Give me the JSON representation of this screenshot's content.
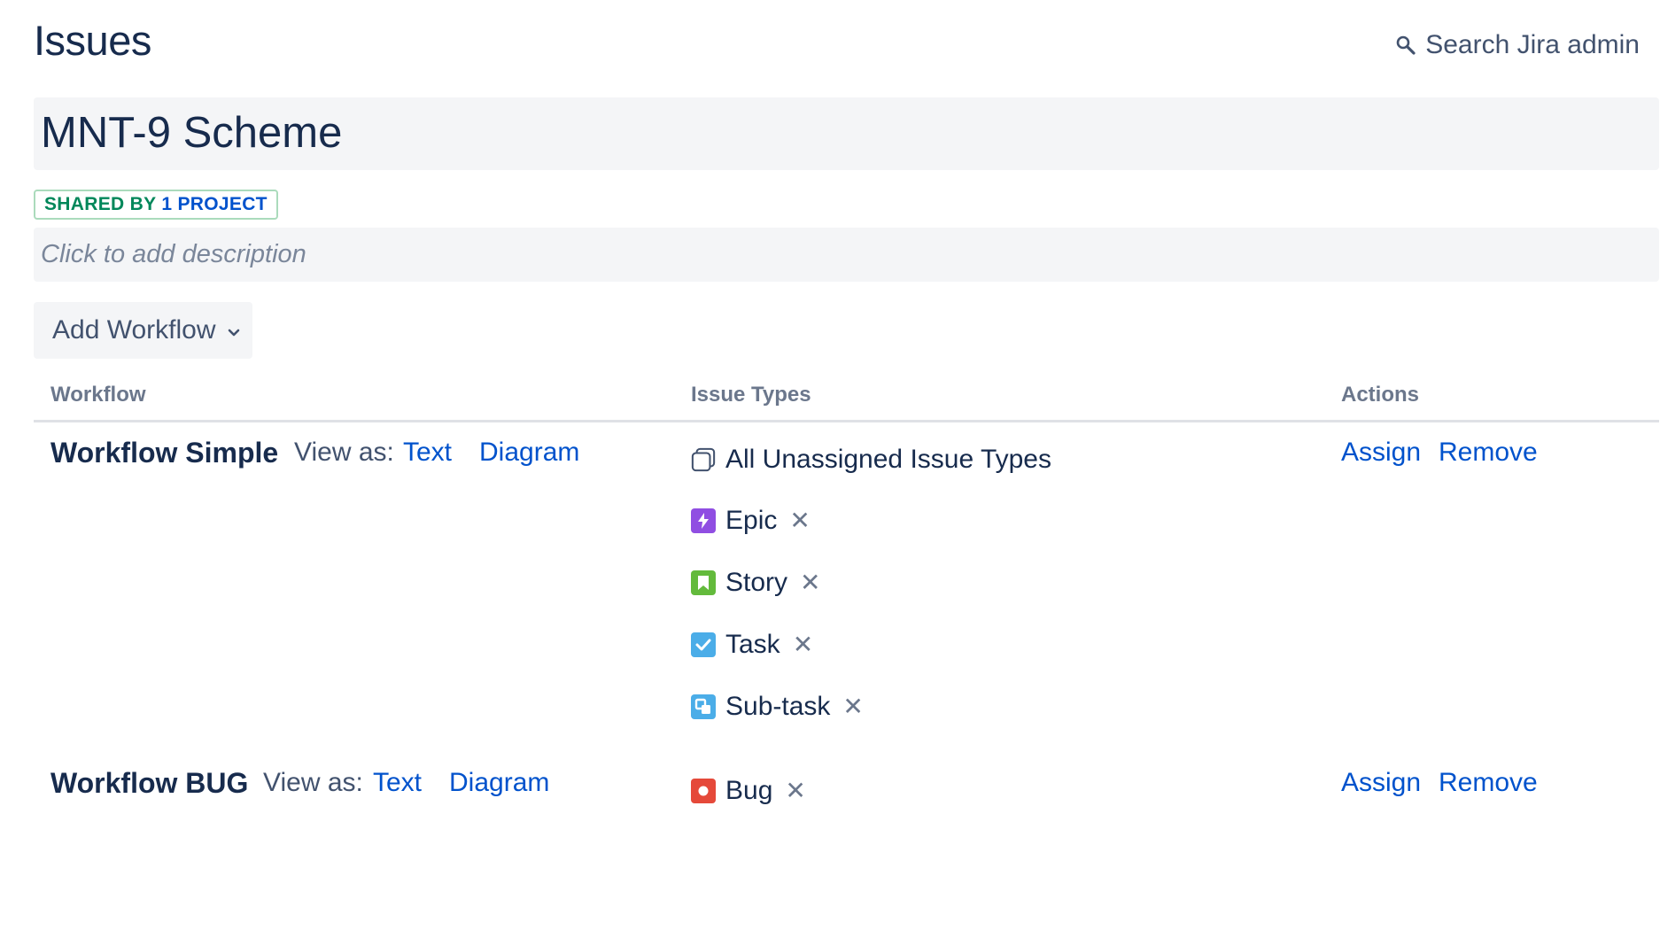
{
  "header": {
    "title": "Issues",
    "search_label": "Search Jira admin"
  },
  "scheme": {
    "name": "MNT-9 Scheme",
    "shared_prefix": "SHARED BY",
    "shared_count": "1 PROJECT",
    "description_placeholder": "Click to add description"
  },
  "toolbar": {
    "add_workflow_label": "Add Workflow"
  },
  "table": {
    "columns": [
      "Workflow",
      "Issue Types",
      "Actions"
    ],
    "rows": [
      {
        "name": "Workflow Simple",
        "view_as_label": "View as:",
        "text_link": "Text",
        "diagram_link": "Diagram",
        "assign_label": "Assign",
        "remove_label": "Remove",
        "issue_types": [
          {
            "label": "All Unassigned Issue Types",
            "icon": "unassigned-icon",
            "removable": false
          },
          {
            "label": "Epic",
            "icon": "epic-icon",
            "color": "#904EE2",
            "removable": true
          },
          {
            "label": "Story",
            "icon": "story-icon",
            "color": "#63BA3C",
            "removable": true
          },
          {
            "label": "Task",
            "icon": "task-icon",
            "color": "#4BADE8",
            "removable": true
          },
          {
            "label": "Sub-task",
            "icon": "subtask-icon",
            "color": "#4BADE8",
            "removable": true
          }
        ]
      },
      {
        "name": "Workflow BUG",
        "view_as_label": "View as:",
        "text_link": "Text",
        "diagram_link": "Diagram",
        "assign_label": "Assign",
        "remove_label": "Remove",
        "issue_types": [
          {
            "label": "Bug",
            "icon": "bug-icon",
            "color": "#E5493A",
            "removable": true
          }
        ]
      }
    ]
  },
  "remove_glyph": "✕"
}
